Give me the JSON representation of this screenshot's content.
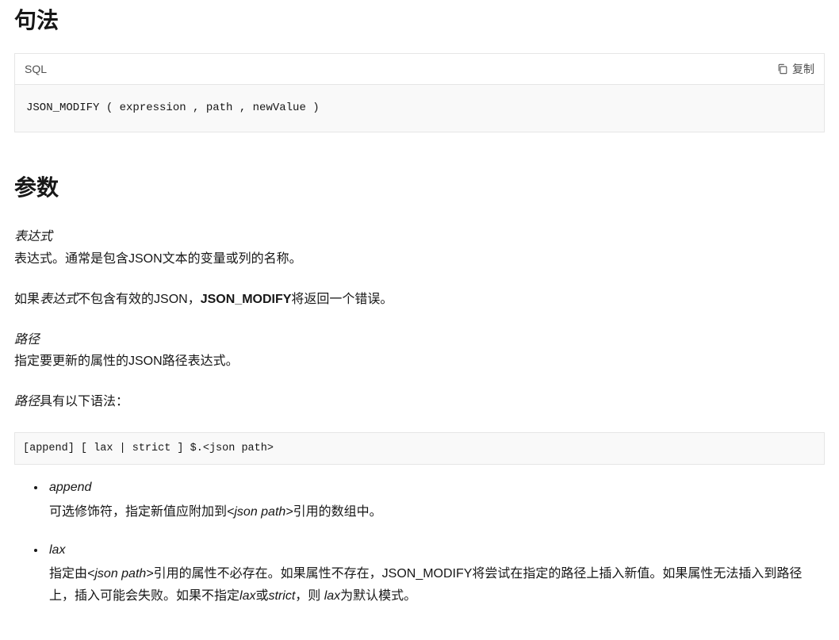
{
  "syntax": {
    "heading": "句法",
    "code_lang": "SQL",
    "copy_label": "复制",
    "code_content": "JSON_MODIFY ( expression , path , newValue )"
  },
  "params": {
    "heading": "参数",
    "expression": {
      "term": "表达式",
      "desc": "表达式。通常是包含JSON文本的变量或列的名称。",
      "err_prefix": "如果",
      "err_term": "表达式",
      "err_mid": "不包含有效的JSON，",
      "err_func": "JSON_MODIFY",
      "err_suffix": "将返回一个错误。"
    },
    "path": {
      "term": "路径",
      "desc": "指定要更新的属性的JSON路径表达式。",
      "syntax_intro_term": "路径",
      "syntax_intro_suffix": "具有以下语法：",
      "syntax_code": "[append] [ lax | strict ] $.<json path>"
    },
    "options": {
      "append": {
        "name": "append",
        "desc_prefix": "可选修饰符，指定新值应附加到",
        "desc_term": "<json path>",
        "desc_suffix": "引用的数组中。"
      },
      "lax": {
        "name": "lax",
        "desc_prefix": "指定由",
        "desc_term": "<json path>",
        "desc_mid": "引用的属性不必存在。如果属性不存在，JSON_MODIFY将尝试在指定的路径上插入新值。如果属性无法插入到路径上，插入可能会失败。如果不指定",
        "desc_term_lax": "lax",
        "desc_or": "或",
        "desc_term_strict": "strict",
        "desc_then": "，则 ",
        "desc_term_lax2": "lax",
        "desc_suffix": "为默认模式。"
      }
    }
  }
}
